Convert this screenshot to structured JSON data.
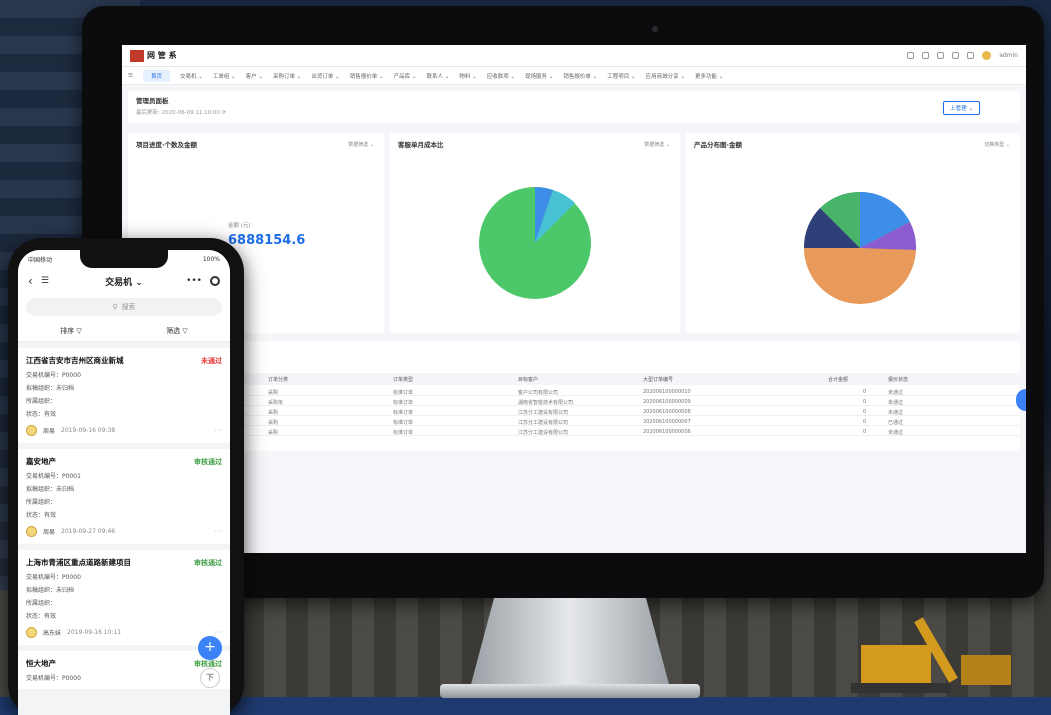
{
  "desktop": {
    "logo_text": "网 管 系",
    "top_user": "admin",
    "nav": [
      {
        "label": "首页"
      },
      {
        "label": "交易机 ⌄"
      },
      {
        "label": "工单组 ⌄"
      },
      {
        "label": "客户 ⌄"
      },
      {
        "label": "采购订单 ⌄"
      },
      {
        "label": "出货订单 ⌄"
      },
      {
        "label": "销售报价单 ⌄"
      },
      {
        "label": "产品库 ⌄"
      },
      {
        "label": "联系人 ⌄"
      },
      {
        "label": "物料 ⌄"
      },
      {
        "label": "应收款项 ⌄"
      },
      {
        "label": "现场服务 ⌄"
      },
      {
        "label": "销售报价单 ⌄"
      },
      {
        "label": "工程项目 ⌄"
      },
      {
        "label": "应用商城分享 ⌄"
      },
      {
        "label": "更多功能 ⌄"
      }
    ],
    "subhead_title": "管理员面板",
    "subhead_sub": "最后更新: 2020-06-09 11:10:00 ⟳",
    "subhead_button": "上管理 ⌄",
    "card1": {
      "title": "项目进度·个数及金额",
      "sub": "",
      "right": "数据筛选 ⌄",
      "label": "金额 (元)",
      "value": "6888154.6"
    },
    "card2": {
      "title": "客服单月成本比",
      "right": "数据筛选 ⌄"
    },
    "card3": {
      "title": "产品分布图·金额",
      "right": "切换类型 ⌄"
    },
    "table": {
      "headers": [
        "订单分类",
        "订单类型",
        "目标客户",
        "大型订单编号",
        "合计金额",
        "报价状态"
      ],
      "rows": [
        [
          "采购",
          "标准订单",
          "客户公司有限公司",
          "202006100000010",
          "0",
          "未通过"
        ],
        [
          "采购单",
          "标准订单",
          "湖南省智能技术有限公司",
          "202006100000009",
          "0",
          "未通过"
        ],
        [
          "采购",
          "标准订单",
          "江苏分工建设有限公司",
          "202006100000008",
          "0",
          "未通过"
        ],
        [
          "采购",
          "标准订单",
          "江苏分工建设有限公司",
          "202006100000007",
          "0",
          "已通过"
        ],
        [
          "采购",
          "标准订单",
          "江苏分工建设有限公司",
          "202006100000006",
          "0",
          "未通过"
        ]
      ]
    }
  },
  "phone": {
    "status_left": "中国移动",
    "status_right": "100%",
    "title": "交易机 ⌄",
    "search_placeholder": "搜索",
    "sort_label": "排序 ▽",
    "filter_label": "筛选 ▽",
    "cards": [
      {
        "title": "江西省吉安市吉州区商业新城",
        "status": "未通过",
        "status_color": "#e53935",
        "line1": "交易机编号：P0000",
        "line2": "拟稿组织：未归档",
        "line3": "所属组织：",
        "line4": "状态：有效",
        "user": "周易",
        "time": "2019-09-16 09:38"
      },
      {
        "title": "嘉安地产",
        "status": "审核通过",
        "status_color": "#43a047",
        "line1": "交易机编号：P0001",
        "line2": "拟稿组织：未归档",
        "line3": "所属组织：",
        "line4": "状态：有效",
        "user": "周易",
        "time": "2019-09-27 09:46"
      },
      {
        "title": "上海市青浦区重点道路新建项目",
        "status": "审核通过",
        "status_color": "#43a047",
        "line1": "交易机编号：P0000",
        "line2": "拟稿组织：未归档",
        "line3": "所属组织：",
        "line4": "状态：有效",
        "user": "高东妹",
        "time": "2019-09-16 10:11"
      },
      {
        "title": "恒大地产",
        "status": "审核通过",
        "status_color": "#43a047",
        "line1": "交易机编号：P0000"
      }
    ],
    "fab_label": "+",
    "fab2_label": "下"
  }
}
